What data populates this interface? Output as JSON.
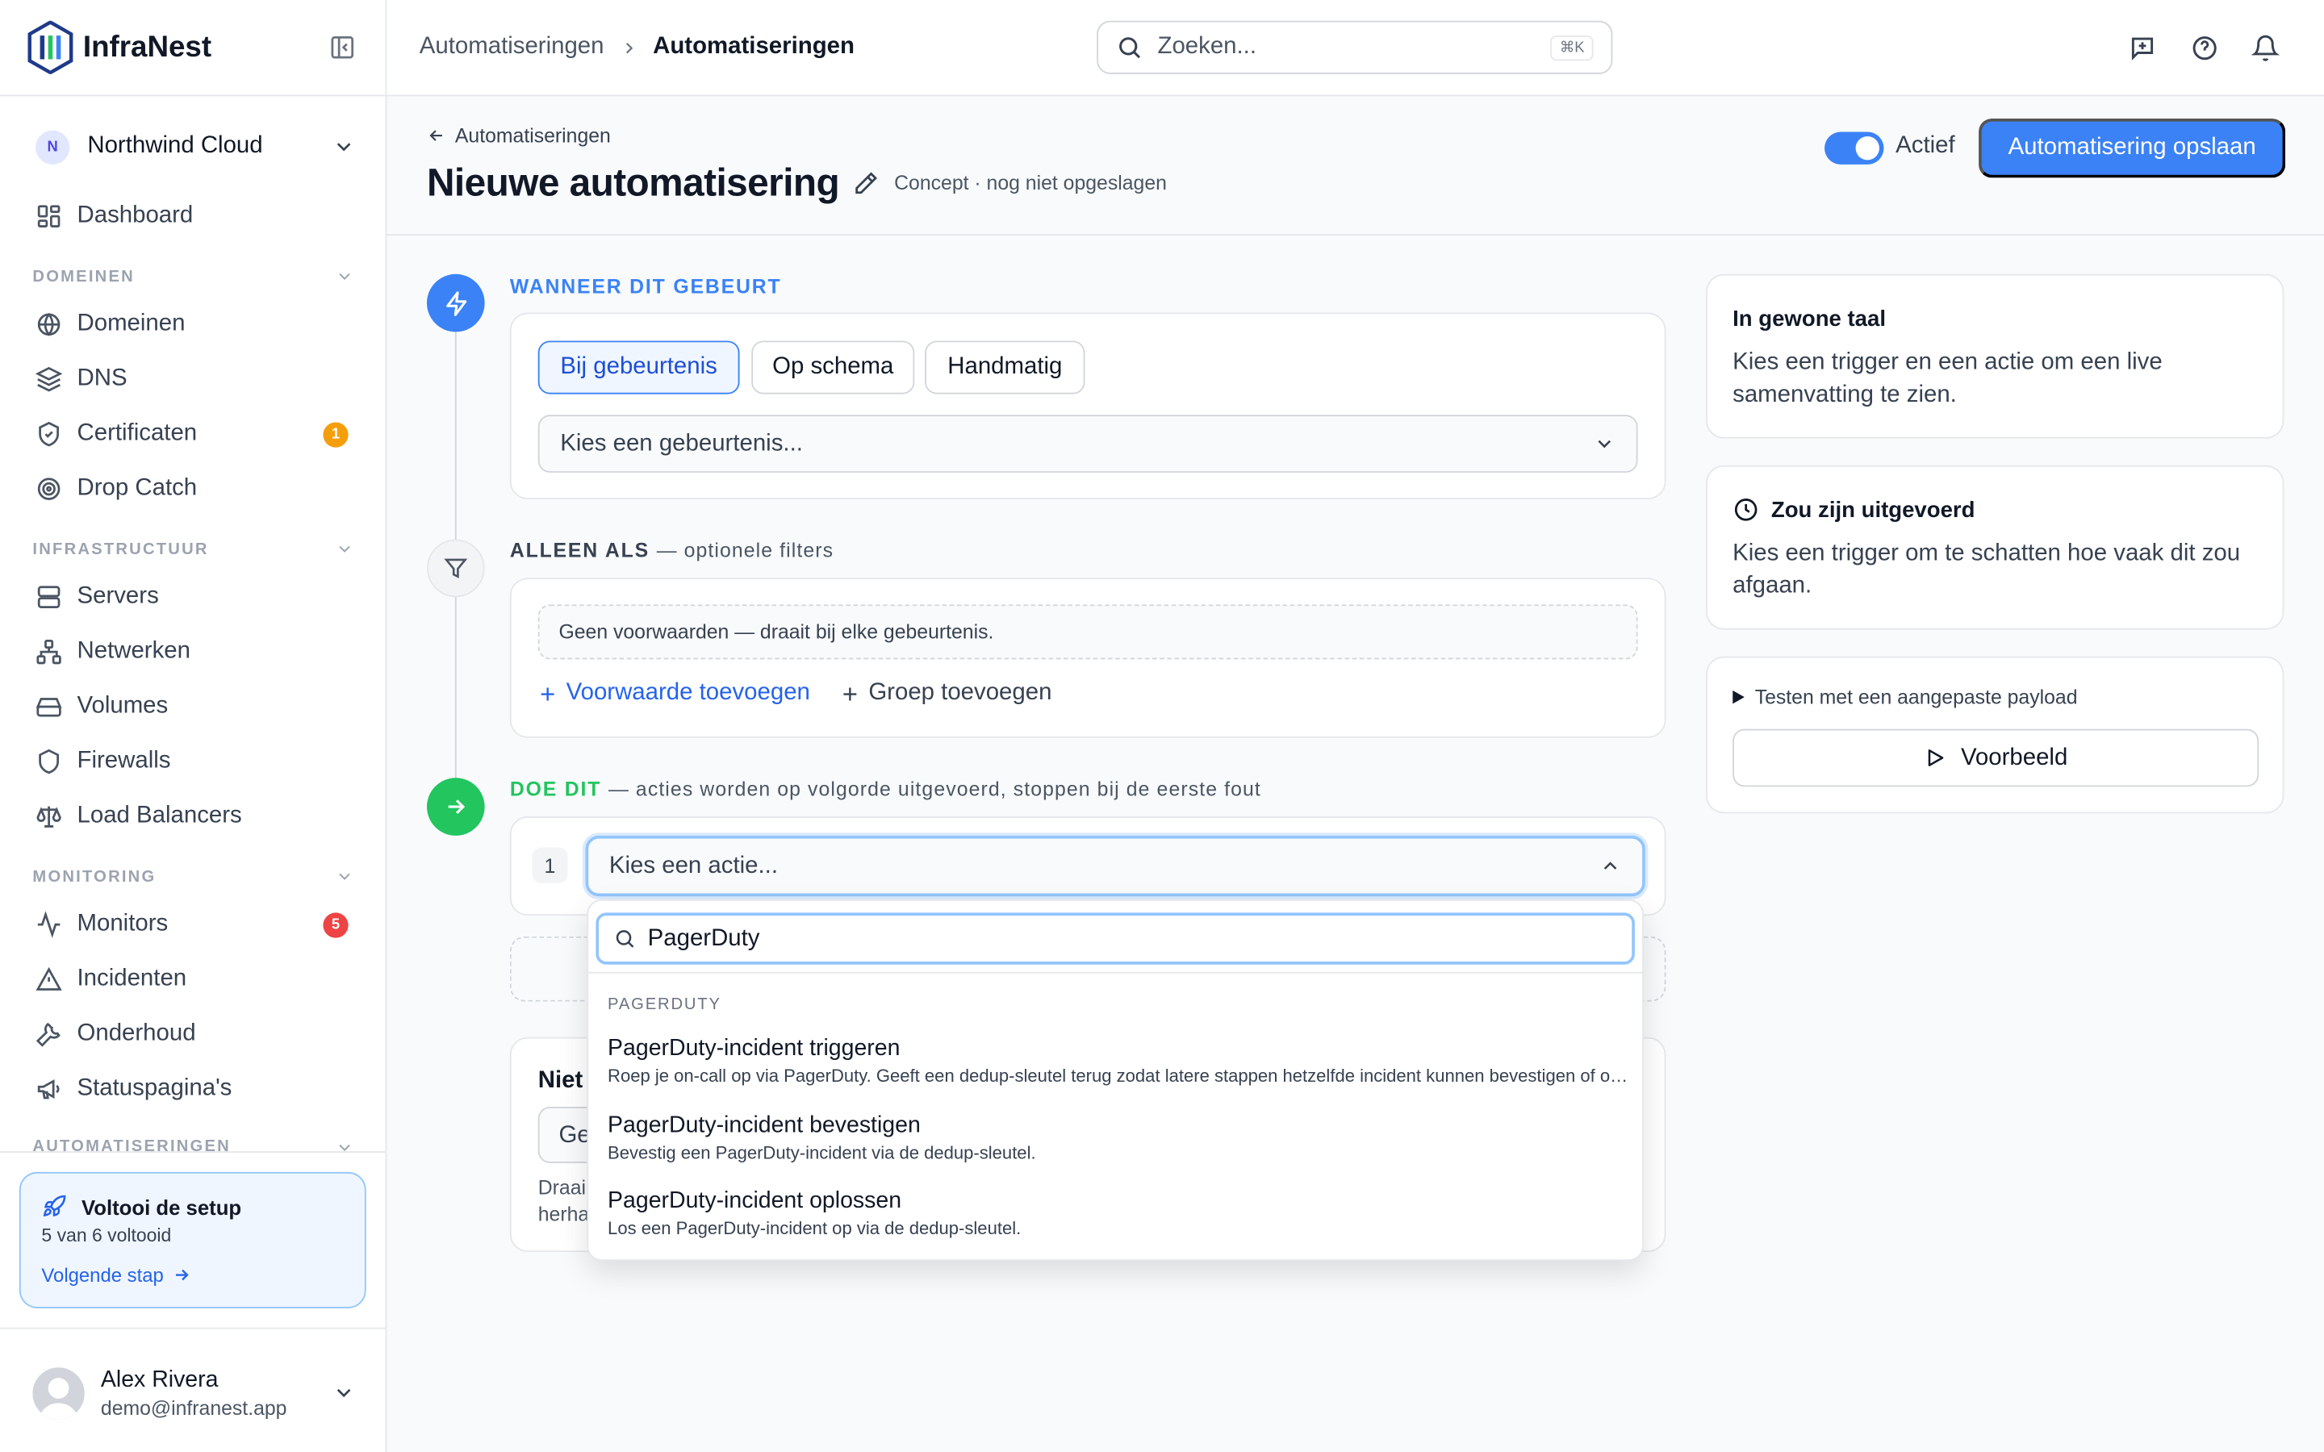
{
  "brand": {
    "name": "InfraNest"
  },
  "org": {
    "initial": "N",
    "name": "Northwind Cloud"
  },
  "nav": {
    "dashboard": "Dashboard",
    "sections": {
      "domains": "DOMEINEN",
      "infrastructure": "INFRASTRUCTUUR",
      "monitoring": "MONITORING",
      "automations": "AUTOMATISERINGEN"
    },
    "domains": "Domeinen",
    "dns": "DNS",
    "certificates": "Certificaten",
    "certificates_badge": "1",
    "drop_catch": "Drop Catch",
    "servers": "Servers",
    "networks": "Netwerken",
    "volumes": "Volumes",
    "firewalls": "Firewalls",
    "load_balancers": "Load Balancers",
    "monitors": "Monitors",
    "monitors_badge": "5",
    "incidents": "Incidenten",
    "maintenance": "Onderhoud",
    "status_pages": "Statuspagina's"
  },
  "setup": {
    "title": "Voltooi de setup",
    "progress": "5 van 6 voltooid",
    "next": "Volgende stap"
  },
  "user": {
    "name": "Alex Rivera",
    "email": "demo@infranest.app"
  },
  "topbar": {
    "breadcrumb": [
      "Automatiseringen",
      "Automatiseringen"
    ],
    "search_placeholder": "Zoeken...",
    "search_shortcut": "⌘K"
  },
  "page": {
    "back_label": "Automatiseringen",
    "title": "Nieuwe automatisering",
    "status": "Concept · nog niet opgeslagen",
    "active_label": "Actief",
    "active": true,
    "save_label": "Automatisering opslaan"
  },
  "trigger": {
    "heading": "WANNEER DIT GEBEURT",
    "tabs": [
      "Bij gebeurtenis",
      "Op schema",
      "Handmatig"
    ],
    "active_tab": "Bij gebeurtenis",
    "event_placeholder": "Kies een gebeurtenis..."
  },
  "filters": {
    "heading": "ALLEEN ALS",
    "subheading": "— optionele filters",
    "empty": "Geen voorwaarden — draait bij elke gebeurtenis.",
    "add_condition": "Voorwaarde toevoegen",
    "add_group": "Groep toevoegen"
  },
  "actions": {
    "heading": "DOE DIT",
    "subheading": "— acties worden op volgorde uitgevoerd, stoppen bij de eerste fout",
    "step_number": "1",
    "select_placeholder": "Kies een actie...",
    "behind_title": "Niet",
    "behind_select": "Ge",
    "behind_desc_1": "Draai",
    "behind_desc_2": "herha"
  },
  "dropdown": {
    "query": "PagerDuty",
    "group": "PAGERDUTY",
    "items": [
      {
        "title": "PagerDuty-incident triggeren",
        "desc": "Roep je on-call op via PagerDuty. Geeft een dedup-sleutel terug zodat latere stappen hetzelfde incident kunnen bevestigen of oplossen."
      },
      {
        "title": "PagerDuty-incident bevestigen",
        "desc": "Bevestig een PagerDuty-incident via de dedup-sleutel."
      },
      {
        "title": "PagerDuty-incident oplossen",
        "desc": "Los een PagerDuty-incident op via de dedup-sleutel."
      }
    ]
  },
  "summary": {
    "title": "In gewone taal",
    "text": "Kies een trigger en een actie om een live samenvatting te zien."
  },
  "would_run": {
    "title": "Zou zijn uitgevoerd",
    "text": "Kies een trigger om te schatten hoe vaak dit zou afgaan."
  },
  "test": {
    "label": "Testen met een aangepaste payload",
    "button": "Voorbeeld"
  },
  "colors": {
    "accent": "#3b82f6",
    "success": "#22c55e",
    "warning": "#f59e0b",
    "danger": "#ef4444"
  }
}
